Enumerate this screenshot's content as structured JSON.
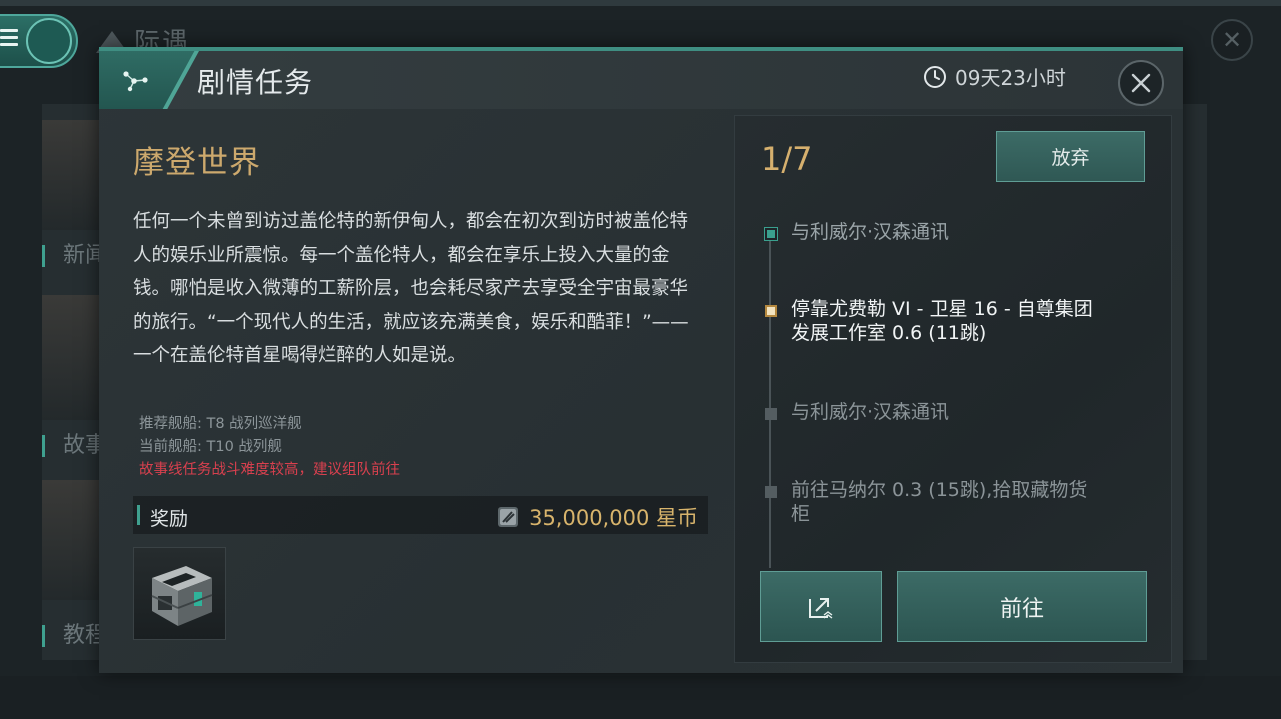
{
  "background": {
    "title": "际遇",
    "left_labels": [
      "新闻",
      "故事",
      "教程"
    ]
  },
  "header": {
    "title": "剧情任务",
    "timer": "09天23小时"
  },
  "mission": {
    "title": "摩登世界",
    "description": "任何一个未曾到访过盖伦特的新伊甸人，都会在初次到访时被盖伦特人的娱乐业所震惊。每一个盖伦特人，都会在享乐上投入大量的金钱。哪怕是收入微薄的工薪阶层，也会耗尽家产去享受全宇宙最豪华的旅行。“一个现代人的生活，就应该充满美食，娱乐和酷菲！”——一个在盖伦特首星喝得烂醉的人如是说。",
    "recommended_ship": "推荐舰船: T8 战列巡洋舰",
    "current_ship": "当前舰船: T10 战列舰",
    "warning": "故事线任务战斗难度较高，建议组队前往",
    "reward": {
      "label": "奖励",
      "value": "35,000,000 星币"
    }
  },
  "progress": {
    "counter": "1/7",
    "abandon_label": "放弃",
    "steps": [
      {
        "label": "与利威尔·汉森通讯",
        "status": "done"
      },
      {
        "label": "停靠尤费勒 VI - 卫星 16 - 自尊集团 发展工作室 0.6 (11跳)",
        "status": "current"
      },
      {
        "label": "与利威尔·汉森通讯",
        "status": "pending"
      },
      {
        "label": "前往马纳尔 0.3 (15跳),拾取藏物货柜",
        "status": "pending"
      }
    ],
    "go_label": "前往"
  },
  "colors": {
    "accent_teal": "#3fa08f",
    "title_gold": "#cda96d",
    "warning_red": "#d8404e"
  },
  "icons": {
    "menu": "menu-icon",
    "tab": "network-nodes-icon",
    "timer": "clock-icon",
    "close": "close-icon",
    "currency": "isk-coin-icon",
    "reward_item": "cargo-crate-icon",
    "share": "share-icon"
  }
}
